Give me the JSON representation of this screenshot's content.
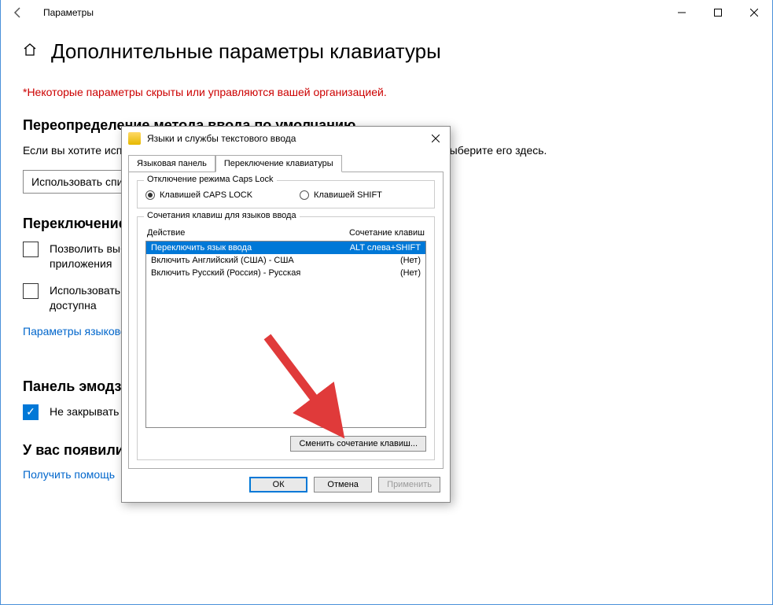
{
  "titlebar": {
    "title": "Параметры"
  },
  "page": {
    "title": "Дополнительные параметры клавиатуры",
    "warning": "*Некоторые параметры скрыты или управляются вашей организацией."
  },
  "sections": {
    "override": {
      "heading": "Переопределение метода ввода по умолчанию",
      "text": "Если вы хотите использовать метод ввода, отличный от первого в списке языков, выберите его здесь.",
      "combo_value": "Использовать список языков (рекомендуется)"
    },
    "switching": {
      "heading": "Переключение методов ввода",
      "checkbox1": "Позволить выбирать метод ввода для каждого окна приложения",
      "checkbox2": "Использовать языковую панель на рабочем столе, если она доступна",
      "link": "Параметры языковой панели"
    },
    "emoji": {
      "heading": "Панель эмодзи",
      "checkbox": "Не закрывать панель автоматически после ввода эмодзи"
    },
    "help": {
      "heading": "У вас появились вопросы?",
      "link": "Получить помощь"
    }
  },
  "dialog": {
    "title": "Языки и службы текстового ввода",
    "tabs": {
      "tab1": "Языковая панель",
      "tab2": "Переключение клавиатуры"
    },
    "capslock_group": {
      "title": "Отключение режима Caps Lock",
      "radio1": "Клавишей CAPS LOCK",
      "radio2": "Клавишей SHIFT"
    },
    "hotkeys_group": {
      "title": "Сочетания клавиш для языков ввода",
      "col_action": "Действие",
      "col_hotkey": "Сочетание клавиш",
      "rows": [
        {
          "action": "Переключить язык ввода",
          "hotkey": "ALT слева+SHIFT"
        },
        {
          "action": "Включить Английский (США) - США",
          "hotkey": "(Нет)"
        },
        {
          "action": "Включить Русский (Россия) - Русская",
          "hotkey": "(Нет)"
        }
      ],
      "change_button": "Сменить сочетание клавиш..."
    },
    "buttons": {
      "ok": "ОК",
      "cancel": "Отмена",
      "apply": "Применить"
    }
  }
}
